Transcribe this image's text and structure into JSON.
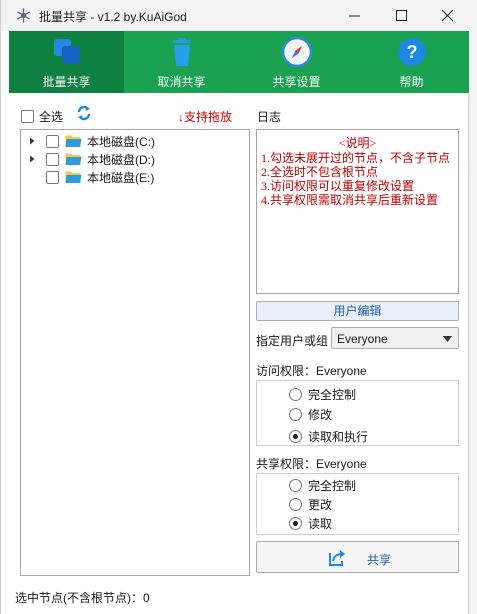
{
  "window": {
    "title": "批量共享 - v1.2 by.KuAiGod"
  },
  "toolbar": {
    "items": [
      {
        "label": "批量共享",
        "icon": "batch-share-icon",
        "active": true
      },
      {
        "label": "取消共享",
        "icon": "trash-icon",
        "active": false
      },
      {
        "label": "共享设置",
        "icon": "compass-icon",
        "active": false
      },
      {
        "label": "帮助",
        "icon": "help-icon",
        "active": false
      }
    ]
  },
  "left": {
    "select_all_label": "全选",
    "drag_hint": "↓支持拖放",
    "tree": [
      {
        "name": "本地磁盘(C:)",
        "expandable": true,
        "checked": false
      },
      {
        "name": "本地磁盘(D:)",
        "expandable": true,
        "checked": false
      },
      {
        "name": "本地磁盘(E:)",
        "expandable": false,
        "checked": false
      }
    ],
    "status_label": "选中节点(不含根节点)：",
    "status_count": "0"
  },
  "right": {
    "log_label": "日志",
    "log_title": "<说明>",
    "log_lines": [
      "1.勾选未展开过的节点，不含子节点",
      "2.全选时不包含根节点",
      "3.访问权限可以重复修改设置",
      "4.共享权限需取消共享后重新设置"
    ],
    "user_edit_label": "用户编辑",
    "user_group_label": "指定用户或组",
    "user_group_value": "Everyone",
    "access_label": "访问权限：Everyone",
    "access_options": [
      {
        "label": "完全控制",
        "selected": false
      },
      {
        "label": "修改",
        "selected": false
      },
      {
        "label": "读取和执行",
        "selected": true
      }
    ],
    "share_perm_label": "共享权限：Everyone",
    "share_options": [
      {
        "label": "完全控制",
        "selected": false
      },
      {
        "label": "更改",
        "selected": false
      },
      {
        "label": "读取",
        "selected": true
      }
    ],
    "share_button_label": "共享"
  },
  "colors": {
    "toolbar_green": "#1aa251",
    "toolbar_active": "#0e8141",
    "hint_red": "#d40000",
    "log_red": "#c00000",
    "link_blue": "#1e5fb3"
  }
}
